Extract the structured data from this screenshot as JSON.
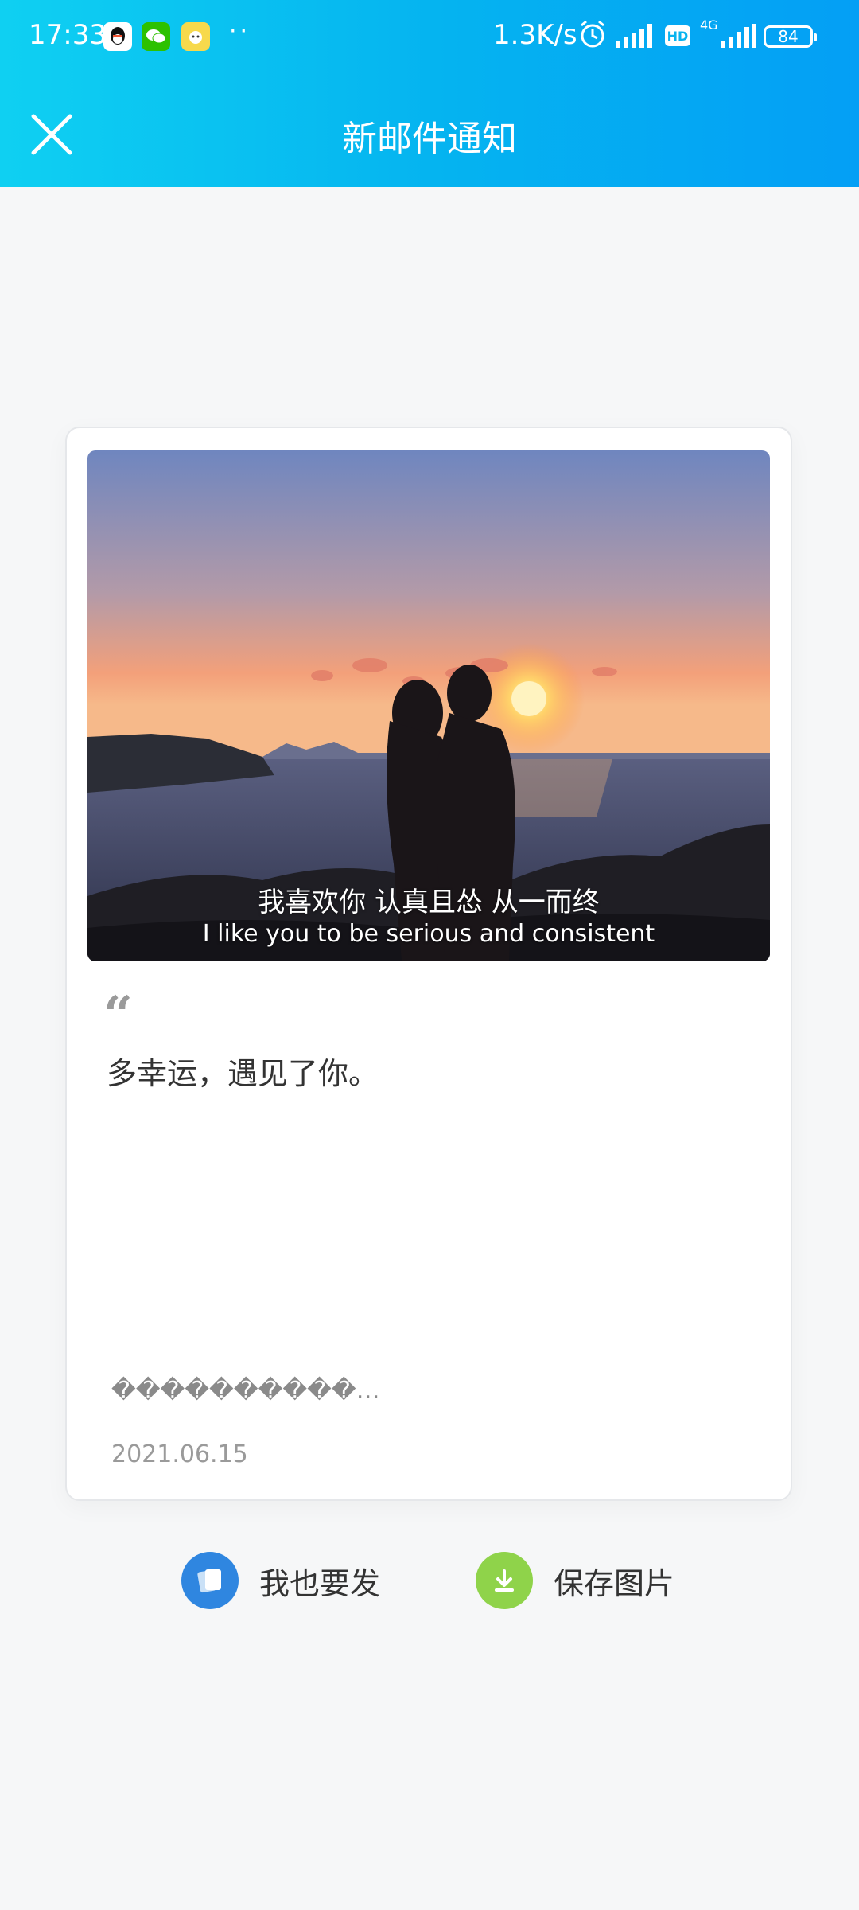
{
  "status_bar": {
    "time": "17:33",
    "dots": "··",
    "network_speed": "1.3K/s",
    "hd": "HD",
    "network_type": "4G",
    "battery": "84"
  },
  "header": {
    "title": "新邮件通知",
    "close_icon": "close-icon"
  },
  "card": {
    "image_caption_zh": "我喜欢你 认真且怂 从一而终",
    "image_caption_en": "I like you to be serious and consistent",
    "quote_mark": "“",
    "message": "多幸运，遇见了你。",
    "sender": "����������…",
    "date": "2021.06.15"
  },
  "actions": {
    "send_label": "我也要发",
    "save_label": "保存图片"
  },
  "colors": {
    "header_start": "#0fd0f2",
    "header_end": "#049ff5",
    "send_icon_bg": "#2f86e0",
    "save_icon_bg": "#8fd34a"
  }
}
